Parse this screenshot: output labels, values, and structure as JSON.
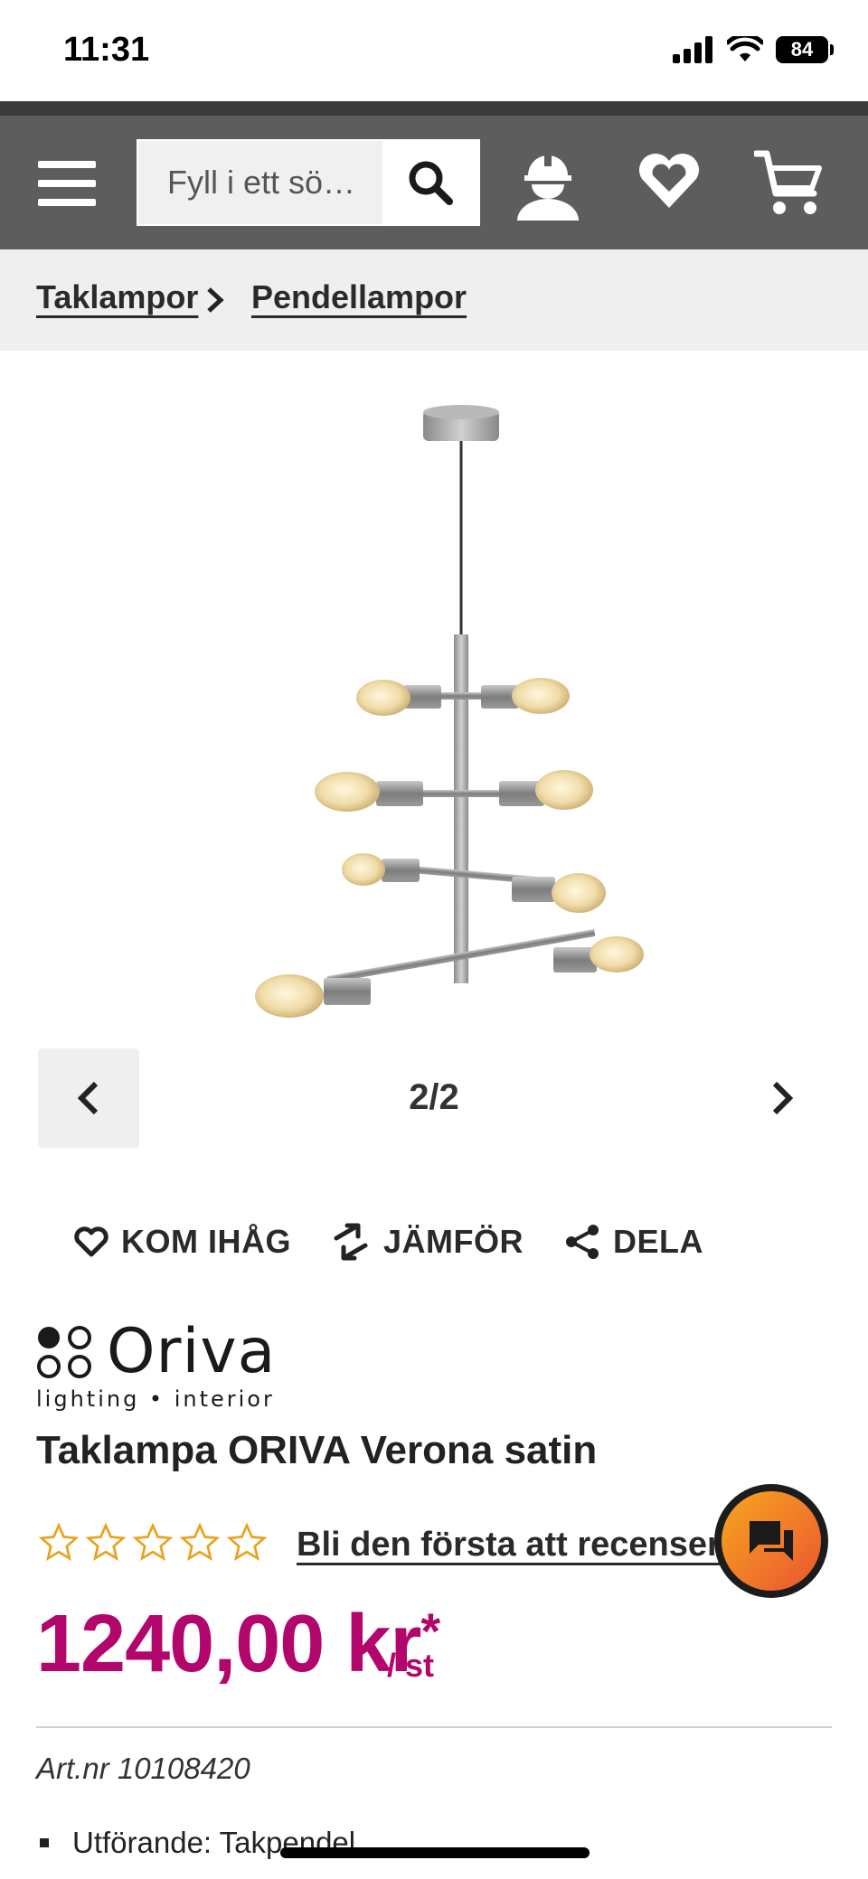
{
  "status": {
    "time": "11:31",
    "battery": "84"
  },
  "search": {
    "placeholder": "Fyll i ett sö…"
  },
  "breadcrumb": {
    "items": [
      "Taklampor",
      "Pendellampor"
    ]
  },
  "gallery": {
    "counter": "2/2"
  },
  "actions": {
    "remember": "KOM IHÅG",
    "compare": "JÄMFÖR",
    "share": "DELA"
  },
  "brand": {
    "name": "Oriva",
    "tagline": "lighting • interior"
  },
  "product": {
    "title": "Taklampa ORIVA Verona satin",
    "rating": 0,
    "rating_max": 5,
    "review_link": "Bli den första att recensera",
    "price": "1240,00 kr",
    "price_mark": "*",
    "unit": "/ st",
    "art_nr": "Art.nr 10108420",
    "features": [
      "Utförande: Takpendel"
    ]
  },
  "colors": {
    "header": "#5d5d5d",
    "price": "#b3066c",
    "star": "#e8a21c",
    "chat_from": "#f7a51c",
    "chat_to": "#e8532f"
  }
}
